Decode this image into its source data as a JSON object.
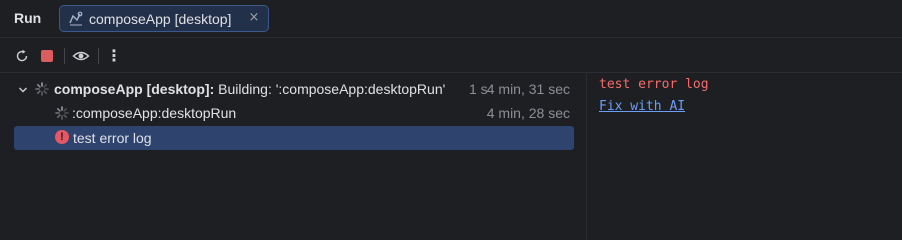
{
  "header": {
    "title": "Run",
    "tab": {
      "label": "composeApp [desktop]",
      "close": "×",
      "icon": "compose-app-icon"
    }
  },
  "toolbar": {
    "buttons": [
      "rerun-icon",
      "stop-icon",
      "eye-icon",
      "more-vertical-icon"
    ],
    "more_label": "⋮"
  },
  "tree": {
    "rows": [
      {
        "name_bold": "composeApp [desktop]:",
        "status": " Building: ':composeApp:desktopRun'",
        "cut": "1 s",
        "time": "4 min, 31 sec"
      },
      {
        "label": ":composeApp:desktopRun",
        "time": "4 min, 28 sec"
      },
      {
        "label": "test error log",
        "error_mark": "!"
      }
    ]
  },
  "console": {
    "error_text": "test error log",
    "link_text": "Fix with AI"
  },
  "colors": {
    "background": "#1e1f22",
    "selection": "#2e436e",
    "tab_bg": "#23304a",
    "tab_border": "#3a5a8c",
    "error": "#e55765",
    "link": "#6d9ef7"
  }
}
